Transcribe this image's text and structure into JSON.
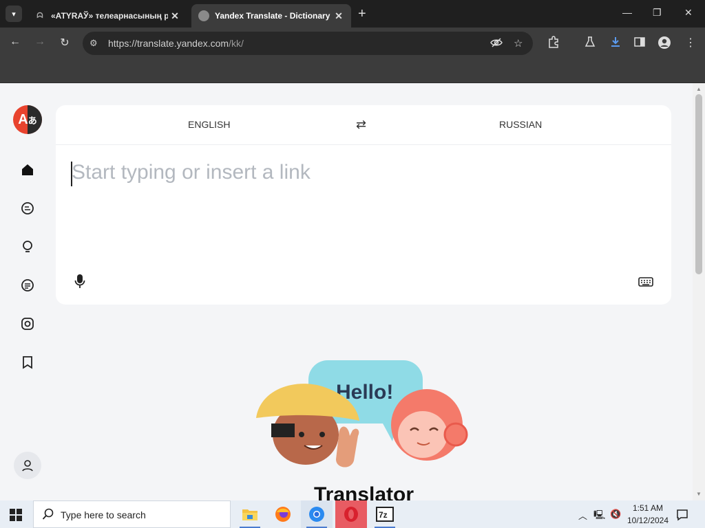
{
  "browser": {
    "tabs": [
      {
        "title": "«ATYRAЎ» телеарнасының ре",
        "favicon": "atyrau-icon",
        "active": false
      },
      {
        "title": "Yandex Translate - Dictionary a",
        "favicon": "yandex-globe-icon",
        "active": true
      }
    ],
    "url": {
      "host": "https://translate.yandex.com",
      "path": "/kk/"
    }
  },
  "translator": {
    "source_lang": "ENGLISH",
    "target_lang": "RUSSIAN",
    "input_placeholder": "Start typing or insert a link",
    "bubble_text": "Hello!",
    "heading": "Translator"
  },
  "sidebar": {
    "items": [
      "home-icon",
      "chat-translate-icon",
      "bulb-icon",
      "document-icon",
      "camera-icon",
      "bookmark-icon"
    ]
  },
  "taskbar": {
    "search_placeholder": "Type here to search",
    "time": "1:51 AM",
    "date": "10/12/2024",
    "apps": [
      "file-explorer-icon",
      "firefox-icon",
      "chrome-icon",
      "opera-icon",
      "7zip-icon"
    ]
  },
  "colors": {
    "accent": "#e8432e",
    "chrome_dark": "#1f1f1f",
    "page_bg": "#f4f5f7"
  }
}
